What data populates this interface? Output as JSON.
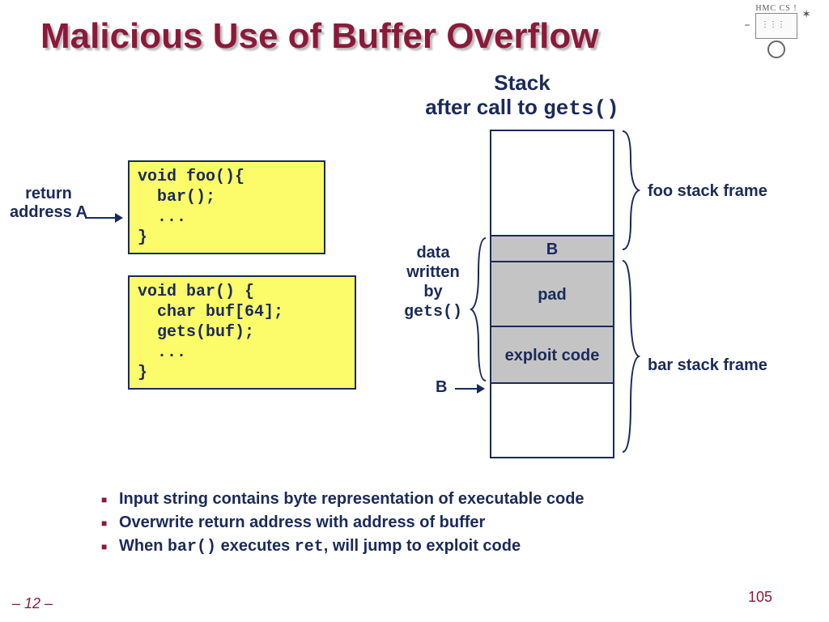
{
  "title": "Malicious Use of Buffer Overflow",
  "logo_text": "HMC CS !",
  "stack_title_line1": "Stack",
  "stack_title_line2_a": "after call to ",
  "stack_title_line2_b": "gets()",
  "return_label": "return address A",
  "code_foo": "void foo(){\n  bar();\n  ...\n}",
  "code_bar": "void bar() {\n  char buf[64];\n  gets(buf);\n  ...\n}",
  "stack": {
    "b": "B",
    "pad": "pad",
    "exploit": "exploit code"
  },
  "data_label_1": "data",
  "data_label_2": "written",
  "data_label_3": "by",
  "data_label_4": "gets()",
  "b_arrow": "B",
  "foo_frame": "foo stack frame",
  "bar_frame": "bar stack frame",
  "bullets": [
    {
      "t": "Input string contains byte representation of executable code"
    },
    {
      "a": "Overwrite return address with address of buffer"
    },
    {
      "a": "When ",
      "b": "bar()",
      "c": " executes ",
      "d": "ret",
      "e": ", will jump to exploit code"
    }
  ],
  "page_left": "– 12 –",
  "page_right": "105"
}
